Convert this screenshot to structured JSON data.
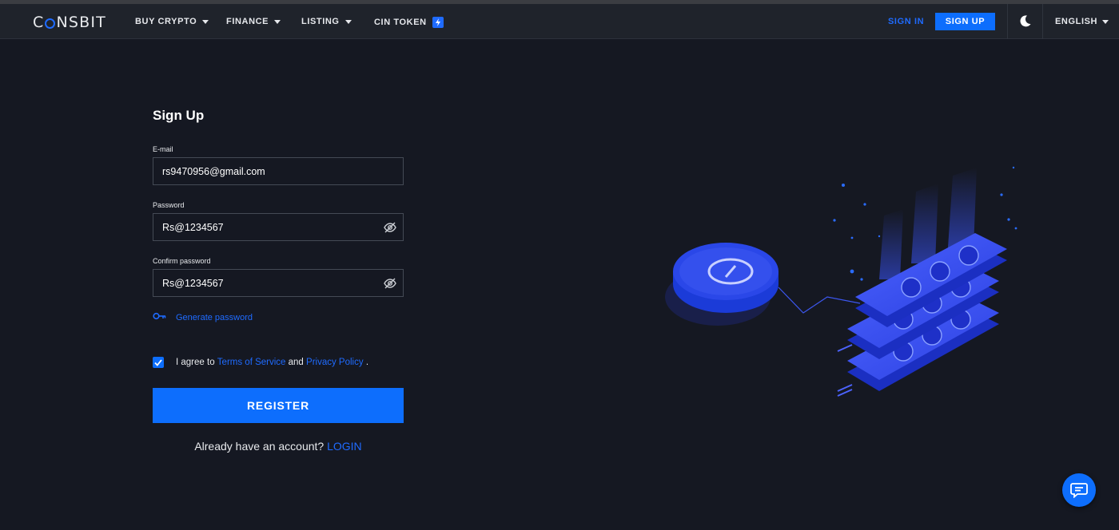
{
  "navbar": {
    "logo": {
      "c": "C",
      "rest": "NSBIT"
    },
    "items": [
      {
        "label": "BUY CRYPTO"
      },
      {
        "label": "FINANCE"
      },
      {
        "label": "LISTING"
      },
      {
        "label": "CIN TOKEN"
      }
    ],
    "sign_in": "SIGN IN",
    "sign_up": "SIGN UP",
    "language": "ENGLISH",
    "icons": {
      "theme": "moon-icon",
      "token": "bolt-icon"
    }
  },
  "form": {
    "title": "Sign Up",
    "email": {
      "label": "E-mail",
      "value": "rs9470956@gmail.com"
    },
    "password": {
      "label": "Password",
      "value": "Rs@1234567"
    },
    "confirm_password": {
      "label": "Confirm password",
      "value": "Rs@1234567"
    },
    "generate_password": "Generate password",
    "agree": {
      "prefix": "I agree to",
      "terms": "Terms of Service",
      "and": "and",
      "privacy": "Privacy Policy",
      "suffix": ".",
      "checked": true
    },
    "register": "REGISTER",
    "already": {
      "text": "Already have an account?",
      "login": "LOGIN"
    }
  },
  "colors": {
    "accent": "#0d6efd",
    "background": "#151822",
    "navbar": "#1f232b"
  }
}
